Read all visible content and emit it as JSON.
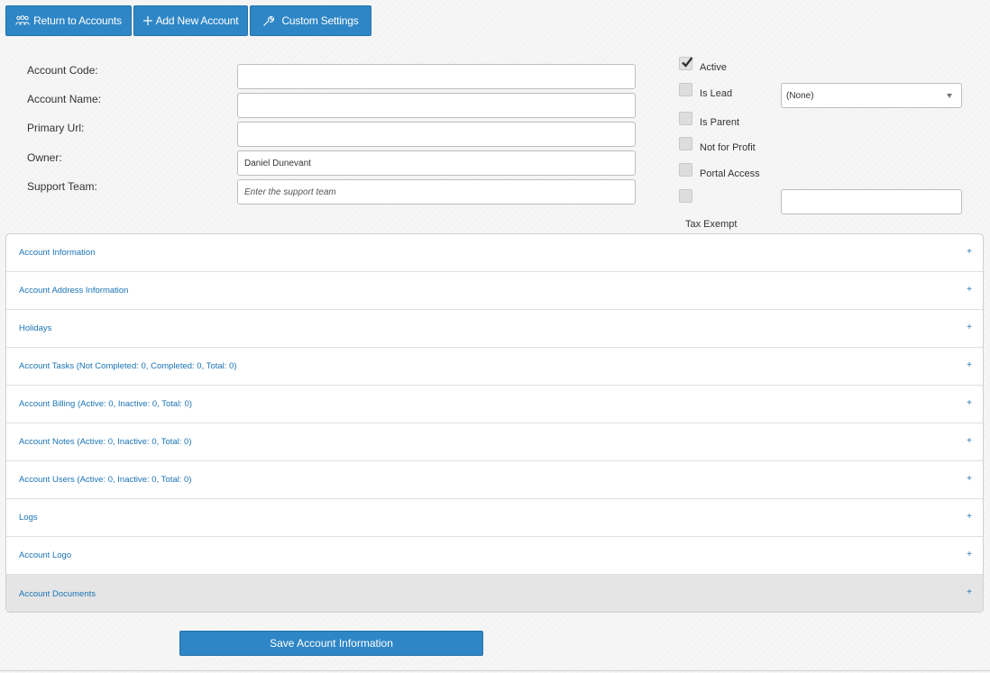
{
  "toolbar": {
    "return_label": "Return to Accounts",
    "add_label": "Add New Account",
    "settings_label": "Custom Settings"
  },
  "form": {
    "account_code_label": "Account Code:",
    "account_code_value": "",
    "account_name_label": "Account Name:",
    "account_name_value": "",
    "primary_url_label": "Primary Url:",
    "primary_url_value": "",
    "owner_label": "Owner:",
    "owner_value": "Daniel Dunevant",
    "support_team_label": "Support Team:",
    "support_team_placeholder": "Enter the support team"
  },
  "flags": {
    "active_label": "Active",
    "active_checked": true,
    "is_lead_label": "Is Lead",
    "is_lead_checked": false,
    "lead_select_value": "(None)",
    "is_parent_label": "Is Parent",
    "is_parent_checked": false,
    "not_for_profit_label": "Not for Profit",
    "not_for_profit_checked": false,
    "portal_access_label": "Portal Access",
    "portal_access_checked": false,
    "tax_exempt_label": "Tax Exempt",
    "tax_exempt_checked": false,
    "tax_exempt_value": ""
  },
  "sections": [
    {
      "label": "Account Information",
      "icon": "+"
    },
    {
      "label": "Account Address Information",
      "icon": "+"
    },
    {
      "label": "Holidays",
      "icon": "+"
    },
    {
      "label": "Account Tasks (Not Completed: 0, Completed: 0, Total: 0)",
      "icon": "+"
    },
    {
      "label": "Account Billing (Active: 0, Inactive: 0, Total: 0)",
      "icon": "+"
    },
    {
      "label": "Account Notes (Active: 0, Inactive: 0, Total: 0)",
      "icon": "+"
    },
    {
      "label": "Account Users (Active: 0, Inactive: 0, Total: 0)",
      "icon": "+"
    },
    {
      "label": "Logs",
      "icon": "+"
    },
    {
      "label": "Account Logo",
      "icon": "+"
    },
    {
      "label": "Account Documents",
      "icon": "+"
    }
  ],
  "save_label": "Save Account Information",
  "colors": {
    "accent": "#2e86c6",
    "link": "#1a73b5",
    "active_row": "#e5e5e5"
  },
  "icons": {
    "return": "users-icon",
    "add": "plus-icon",
    "settings": "wrench-icon",
    "active": "checkmark-icon"
  }
}
